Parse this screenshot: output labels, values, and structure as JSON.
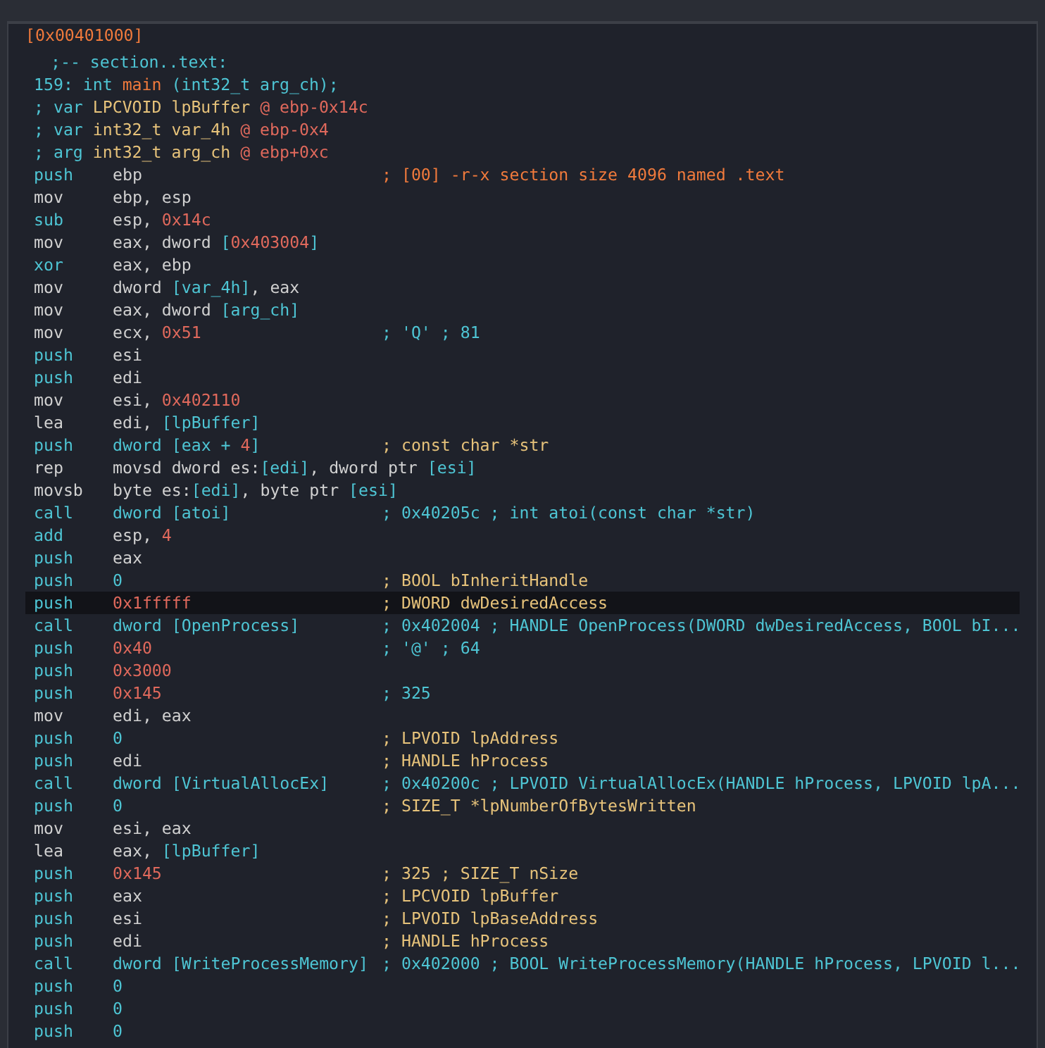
{
  "address": "[0x00401000]",
  "header": [
    [
      {
        "text": ";-- section..text:",
        "kind": "mem"
      }
    ],
    [
      {
        "text": "159: int ",
        "kind": "mem"
      },
      {
        "text": "main",
        "kind": "addr"
      },
      {
        "text": " (int32_t arg_ch);",
        "kind": "mem"
      }
    ],
    [
      {
        "text": "; var ",
        "kind": "mem"
      },
      {
        "text": "LPCVOID lpBuffer ",
        "kind": "type"
      },
      {
        "text": "@ ebp-0x14c",
        "kind": "num"
      }
    ],
    [
      {
        "text": "; var ",
        "kind": "mem"
      },
      {
        "text": "int32_t var_4h ",
        "kind": "type"
      },
      {
        "text": "@ ebp-0x4",
        "kind": "num"
      }
    ],
    [
      {
        "text": "; arg ",
        "kind": "mem"
      },
      {
        "text": "int32_t arg_ch ",
        "kind": "type"
      },
      {
        "text": "@ ebp+0xc",
        "kind": "num"
      }
    ]
  ],
  "lines": [
    {
      "op": {
        "text": "push",
        "kind": "stack"
      },
      "selected": false,
      "args": [
        {
          "text": "ebp",
          "kind": "reg"
        }
      ],
      "comment": {
        "text": "; [00] -r-x section size 4096 named .text",
        "kind": "section"
      }
    },
    {
      "op": {
        "text": "mov",
        "kind": "data"
      },
      "selected": false,
      "args": [
        {
          "text": "ebp, esp",
          "kind": "reg"
        }
      ]
    },
    {
      "op": {
        "text": "sub",
        "kind": "stack"
      },
      "selected": false,
      "args": [
        {
          "text": "esp, ",
          "kind": "reg"
        },
        {
          "text": "0x14c",
          "kind": "num"
        }
      ]
    },
    {
      "op": {
        "text": "mov",
        "kind": "data"
      },
      "selected": false,
      "args": [
        {
          "text": "eax, dword ",
          "kind": "reg"
        },
        {
          "text": "[",
          "kind": "mem"
        },
        {
          "text": "0x403004",
          "kind": "num"
        },
        {
          "text": "]",
          "kind": "mem"
        }
      ]
    },
    {
      "op": {
        "text": "xor",
        "kind": "stack"
      },
      "selected": false,
      "args": [
        {
          "text": "eax, ebp",
          "kind": "reg"
        }
      ]
    },
    {
      "op": {
        "text": "mov",
        "kind": "data"
      },
      "selected": false,
      "args": [
        {
          "text": "dword ",
          "kind": "reg"
        },
        {
          "text": "[var_4h]",
          "kind": "mem"
        },
        {
          "text": ", eax",
          "kind": "reg"
        }
      ]
    },
    {
      "op": {
        "text": "mov",
        "kind": "data"
      },
      "selected": false,
      "args": [
        {
          "text": "eax, dword ",
          "kind": "reg"
        },
        {
          "text": "[arg_ch]",
          "kind": "mem"
        }
      ]
    },
    {
      "op": {
        "text": "mov",
        "kind": "data"
      },
      "selected": false,
      "args": [
        {
          "text": "ecx, ",
          "kind": "reg"
        },
        {
          "text": "0x51",
          "kind": "num"
        }
      ],
      "comment": {
        "text": "; 'Q' ; 81",
        "kind": "info"
      }
    },
    {
      "op": {
        "text": "push",
        "kind": "stack"
      },
      "selected": false,
      "args": [
        {
          "text": "esi",
          "kind": "reg"
        }
      ]
    },
    {
      "op": {
        "text": "push",
        "kind": "stack"
      },
      "selected": false,
      "args": [
        {
          "text": "edi",
          "kind": "reg"
        }
      ]
    },
    {
      "op": {
        "text": "mov",
        "kind": "data"
      },
      "selected": false,
      "args": [
        {
          "text": "esi, ",
          "kind": "reg"
        },
        {
          "text": "0x402110",
          "kind": "num"
        }
      ]
    },
    {
      "op": {
        "text": "lea",
        "kind": "data"
      },
      "selected": false,
      "args": [
        {
          "text": "edi, ",
          "kind": "reg"
        },
        {
          "text": "[lpBuffer]",
          "kind": "mem"
        }
      ]
    },
    {
      "op": {
        "text": "push",
        "kind": "stack"
      },
      "selected": false,
      "args": [
        {
          "text": "dword [eax + ",
          "kind": "mem"
        },
        {
          "text": "4",
          "kind": "num"
        },
        {
          "text": "]",
          "kind": "mem"
        }
      ],
      "comment": {
        "text": "; const char *str",
        "kind": "type"
      }
    },
    {
      "op": {
        "text": "rep",
        "kind": "data"
      },
      "selected": false,
      "args": [
        {
          "text": "movsd dword es:",
          "kind": "reg"
        },
        {
          "text": "[edi]",
          "kind": "mem"
        },
        {
          "text": ", dword ptr ",
          "kind": "reg"
        },
        {
          "text": "[esi]",
          "kind": "mem"
        }
      ]
    },
    {
      "op": {
        "text": "movsb",
        "kind": "data"
      },
      "selected": false,
      "args": [
        {
          "text": "byte es:",
          "kind": "reg"
        },
        {
          "text": "[edi]",
          "kind": "mem"
        },
        {
          "text": ", byte ptr ",
          "kind": "reg"
        },
        {
          "text": "[esi]",
          "kind": "mem"
        }
      ]
    },
    {
      "op": {
        "text": "call",
        "kind": "stack"
      },
      "selected": false,
      "args": [
        {
          "text": "dword [atoi]",
          "kind": "mem"
        }
      ],
      "comment": {
        "text": "; 0x40205c ; int atoi(const char *str)",
        "kind": "info"
      }
    },
    {
      "op": {
        "text": "add",
        "kind": "stack"
      },
      "selected": false,
      "args": [
        {
          "text": "esp, ",
          "kind": "reg"
        },
        {
          "text": "4",
          "kind": "num"
        }
      ]
    },
    {
      "op": {
        "text": "push",
        "kind": "stack"
      },
      "selected": false,
      "args": [
        {
          "text": "eax",
          "kind": "reg"
        }
      ]
    },
    {
      "op": {
        "text": "push",
        "kind": "stack"
      },
      "selected": false,
      "args": [
        {
          "text": "0",
          "kind": "mem"
        }
      ],
      "comment": {
        "text": "; BOOL bInheritHandle",
        "kind": "type"
      }
    },
    {
      "op": {
        "text": "push",
        "kind": "stack"
      },
      "selected": true,
      "args": [
        {
          "text": "0x1fffff",
          "kind": "num"
        }
      ],
      "comment": {
        "text": "; DWORD dwDesiredAccess",
        "kind": "type"
      }
    },
    {
      "op": {
        "text": "call",
        "kind": "stack"
      },
      "selected": false,
      "args": [
        {
          "text": "dword [OpenProcess]",
          "kind": "mem"
        }
      ],
      "comment": {
        "text": "; 0x402004 ; HANDLE OpenProcess(DWORD dwDesiredAccess, BOOL bI...",
        "kind": "info"
      }
    },
    {
      "op": {
        "text": "push",
        "kind": "stack"
      },
      "selected": false,
      "args": [
        {
          "text": "0x40",
          "kind": "num"
        }
      ],
      "comment": {
        "text": "; '@' ; 64",
        "kind": "info"
      }
    },
    {
      "op": {
        "text": "push",
        "kind": "stack"
      },
      "selected": false,
      "args": [
        {
          "text": "0x3000",
          "kind": "num"
        }
      ]
    },
    {
      "op": {
        "text": "push",
        "kind": "stack"
      },
      "selected": false,
      "args": [
        {
          "text": "0x145",
          "kind": "num"
        }
      ],
      "comment": {
        "text": "; 325",
        "kind": "info"
      }
    },
    {
      "op": {
        "text": "mov",
        "kind": "data"
      },
      "selected": false,
      "args": [
        {
          "text": "edi, eax",
          "kind": "reg"
        }
      ]
    },
    {
      "op": {
        "text": "push",
        "kind": "stack"
      },
      "selected": false,
      "args": [
        {
          "text": "0",
          "kind": "mem"
        }
      ],
      "comment": {
        "text": "; LPVOID lpAddress",
        "kind": "type"
      }
    },
    {
      "op": {
        "text": "push",
        "kind": "stack"
      },
      "selected": false,
      "args": [
        {
          "text": "edi",
          "kind": "reg"
        }
      ],
      "comment": {
        "text": "; HANDLE hProcess",
        "kind": "type"
      }
    },
    {
      "op": {
        "text": "call",
        "kind": "stack"
      },
      "selected": false,
      "args": [
        {
          "text": "dword [VirtualAllocEx]",
          "kind": "mem"
        }
      ],
      "comment": {
        "text": "; 0x40200c ; LPVOID VirtualAllocEx(HANDLE hProcess, LPVOID lpA...",
        "kind": "info"
      }
    },
    {
      "op": {
        "text": "push",
        "kind": "stack"
      },
      "selected": false,
      "args": [
        {
          "text": "0",
          "kind": "mem"
        }
      ],
      "comment": {
        "text": "; SIZE_T *lpNumberOfBytesWritten",
        "kind": "type"
      }
    },
    {
      "op": {
        "text": "mov",
        "kind": "data"
      },
      "selected": false,
      "args": [
        {
          "text": "esi, eax",
          "kind": "reg"
        }
      ]
    },
    {
      "op": {
        "text": "lea",
        "kind": "data"
      },
      "selected": false,
      "args": [
        {
          "text": "eax, ",
          "kind": "reg"
        },
        {
          "text": "[lpBuffer]",
          "kind": "mem"
        }
      ]
    },
    {
      "op": {
        "text": "push",
        "kind": "stack"
      },
      "selected": false,
      "args": [
        {
          "text": "0x145",
          "kind": "num"
        }
      ],
      "comment": {
        "text": "; 325 ; SIZE_T nSize",
        "kind": "type"
      }
    },
    {
      "op": {
        "text": "push",
        "kind": "stack"
      },
      "selected": false,
      "args": [
        {
          "text": "eax",
          "kind": "reg"
        }
      ],
      "comment": {
        "text": "; LPCVOID lpBuffer",
        "kind": "type"
      }
    },
    {
      "op": {
        "text": "push",
        "kind": "stack"
      },
      "selected": false,
      "args": [
        {
          "text": "esi",
          "kind": "reg"
        }
      ],
      "comment": {
        "text": "; LPVOID lpBaseAddress",
        "kind": "type"
      }
    },
    {
      "op": {
        "text": "push",
        "kind": "stack"
      },
      "selected": false,
      "args": [
        {
          "text": "edi",
          "kind": "reg"
        }
      ],
      "comment": {
        "text": "; HANDLE hProcess",
        "kind": "type"
      }
    },
    {
      "op": {
        "text": "call",
        "kind": "stack"
      },
      "selected": false,
      "args": [
        {
          "text": "dword [WriteProcessMemory]",
          "kind": "mem"
        }
      ],
      "comment": {
        "text": "; 0x402000 ; BOOL WriteProcessMemory(HANDLE hProcess, LPVOID l...",
        "kind": "info"
      }
    },
    {
      "op": {
        "text": "push",
        "kind": "stack"
      },
      "selected": false,
      "args": [
        {
          "text": "0",
          "kind": "mem"
        }
      ]
    },
    {
      "op": {
        "text": "push",
        "kind": "stack"
      },
      "selected": false,
      "args": [
        {
          "text": "0",
          "kind": "mem"
        }
      ]
    },
    {
      "op": {
        "text": "push",
        "kind": "stack"
      },
      "selected": false,
      "args": [
        {
          "text": "0",
          "kind": "mem"
        }
      ]
    }
  ]
}
